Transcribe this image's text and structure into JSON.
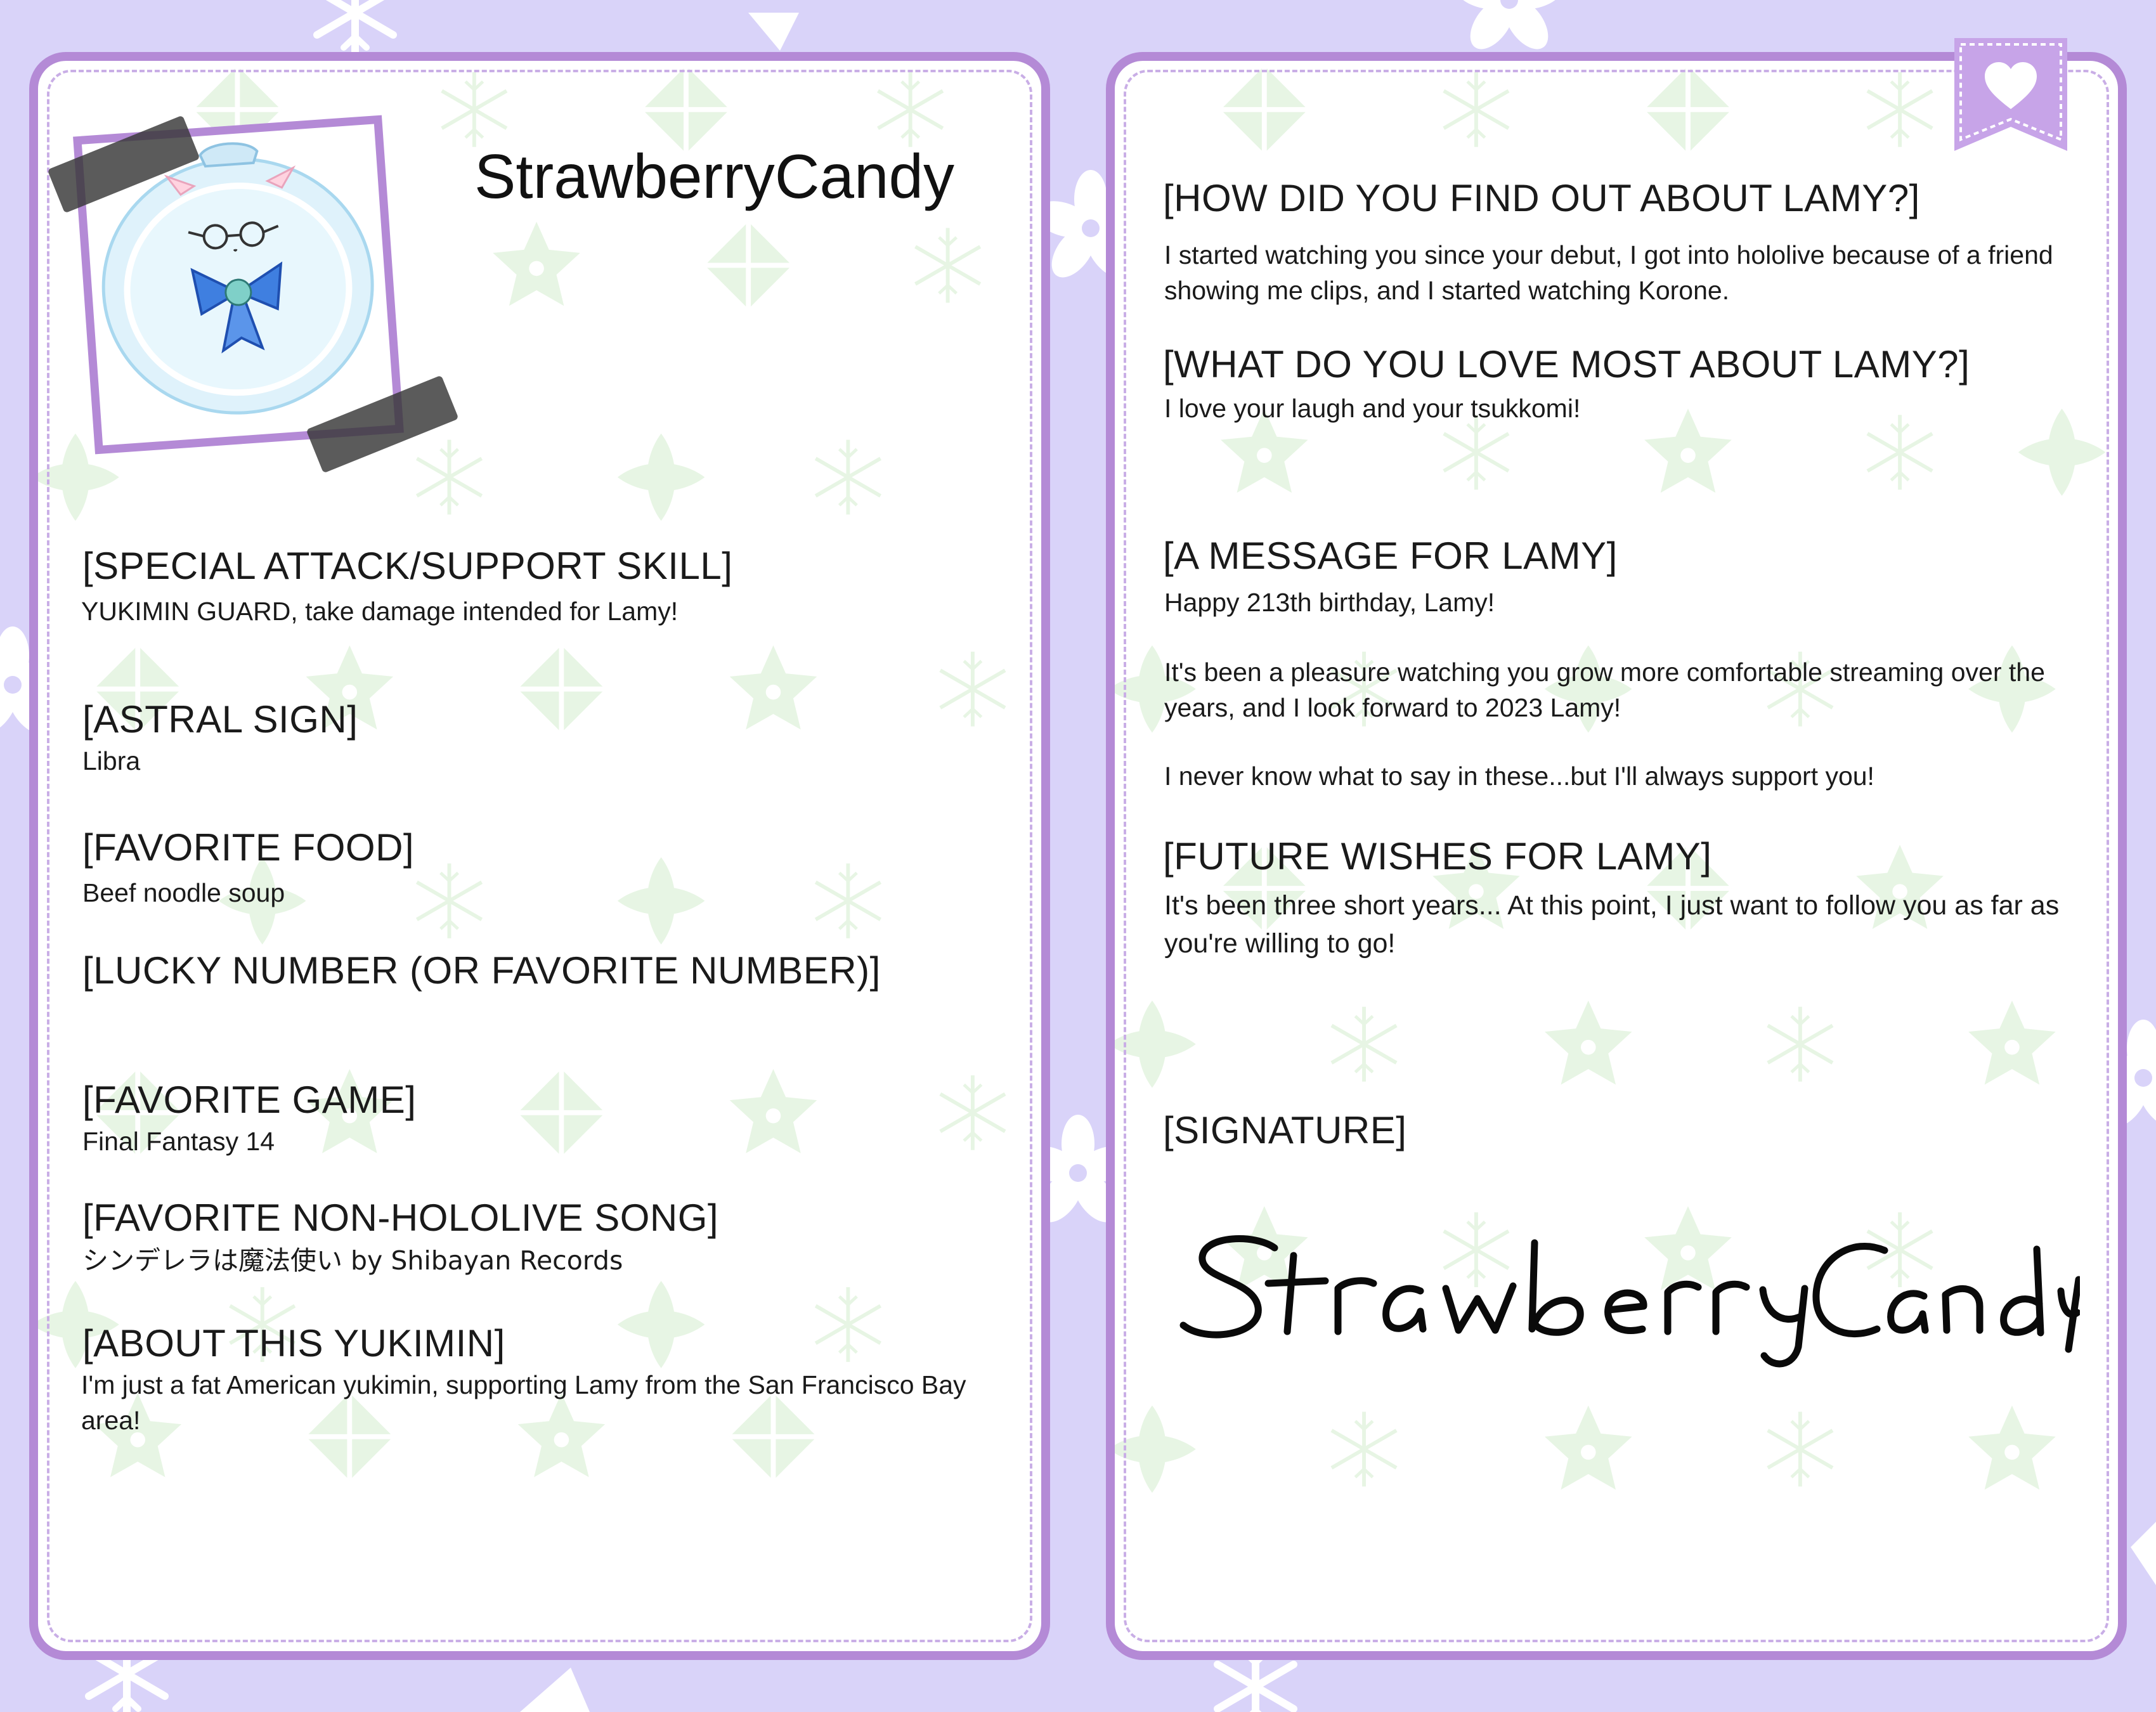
{
  "colors": {
    "background": "#d9d3f9",
    "card_border": "#b48ad6",
    "card_dash": "#c9aee6",
    "pattern": "#e6f4e3",
    "text": "#1a1a1a"
  },
  "left_card": {
    "name": "StrawberryCandy",
    "avatar_icon": "yukimin-avatar-icon",
    "sections": [
      {
        "heading": "[SPECIAL ATTACK/SUPPORT SKILL]",
        "body": "YUKIMIN GUARD, take damage intended for Lamy!"
      },
      {
        "heading": "[ASTRAL SIGN]",
        "body": "Libra"
      },
      {
        "heading": "[FAVORITE FOOD]",
        "body": "Beef noodle soup"
      },
      {
        "heading": "[LUCKY NUMBER (OR FAVORITE NUMBER)]",
        "body": ""
      },
      {
        "heading": "[FAVORITE GAME]",
        "body": "Final Fantasy 14"
      },
      {
        "heading": "[FAVORITE NON-HOLOLIVE SONG]",
        "body": "シンデレラは魔法使い  by  Shibayan Records"
      },
      {
        "heading": "[ABOUT THIS YUKIMIN]",
        "body": "I'm just a fat American yukimin, supporting Lamy from the San Francisco Bay area!"
      }
    ]
  },
  "right_card": {
    "bookmark_icon": "heart-bookmark-icon",
    "sections": [
      {
        "heading": "[HOW DID YOU FIND OUT ABOUT LAMY?]",
        "body": "I started watching you since your debut, I got into hololive because of a friend showing me clips, and I started watching Korone."
      },
      {
        "heading": "[WHAT DO YOU LOVE MOST ABOUT LAMY?]",
        "body": "I love your laugh and your tsukkomi!"
      },
      {
        "heading": "[A MESSAGE FOR LAMY]",
        "body": "Happy 213th birthday, Lamy!",
        "body2": "It's been a pleasure watching you grow more comfortable streaming over the years, and I look forward to 2023 Lamy!",
        "body3": "I never know what to say in these...but I'll always support you!"
      },
      {
        "heading": "[FUTURE WISHES FOR LAMY]",
        "body": "It's been three short years...  At this point, I just want to follow you as far as you're willing to go!"
      },
      {
        "heading": "[SIGNATURE]",
        "body": ""
      }
    ],
    "signature_text": "StrawberryCandy"
  }
}
